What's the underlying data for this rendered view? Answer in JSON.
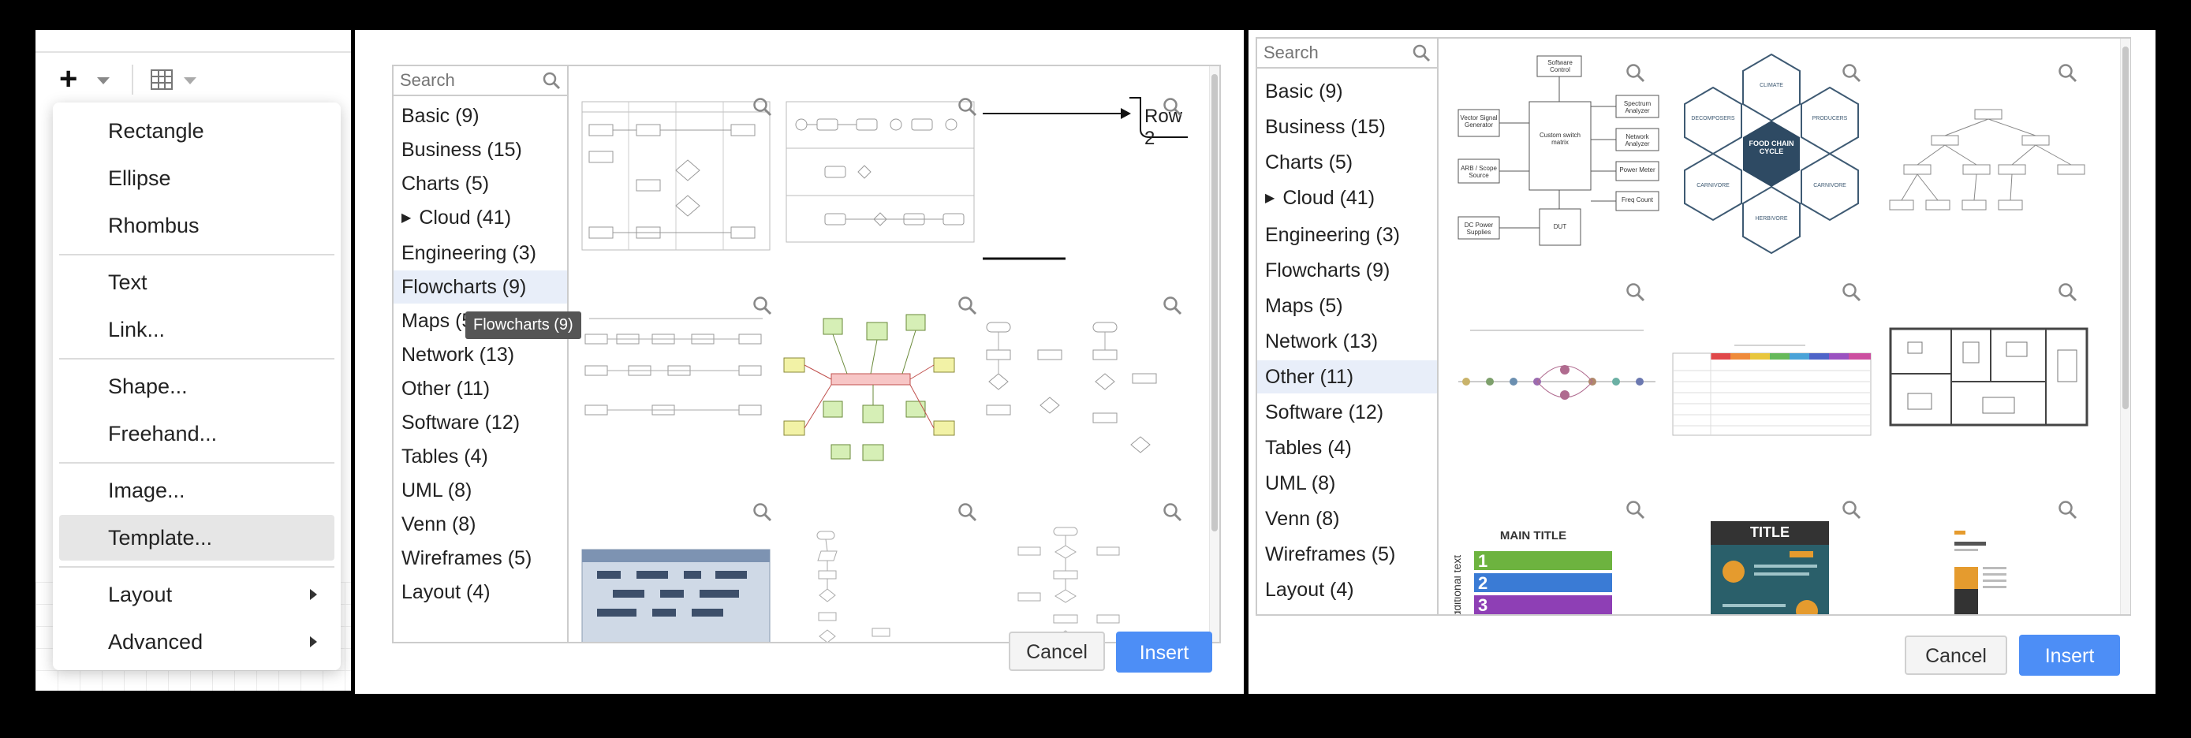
{
  "insert_menu": {
    "items": [
      {
        "label": "Rectangle"
      },
      {
        "label": "Ellipse"
      },
      {
        "label": "Rhombus"
      },
      {
        "label": "Text"
      },
      {
        "label": "Link..."
      },
      {
        "label": "Shape..."
      },
      {
        "label": "Freehand..."
      },
      {
        "label": "Image..."
      },
      {
        "label": "Template..."
      },
      {
        "label": "Layout"
      },
      {
        "label": "Advanced"
      }
    ],
    "active_item": "Template..."
  },
  "dialog_left": {
    "search_placeholder": "Search",
    "categories": [
      {
        "label": "Basic (9)"
      },
      {
        "label": "Business (15)"
      },
      {
        "label": "Charts (5)"
      },
      {
        "label": "Cloud (41)",
        "expandable": true
      },
      {
        "label": "Engineering (3)"
      },
      {
        "label": "Flowcharts (9)",
        "selected": true
      },
      {
        "label": "Maps (5)"
      },
      {
        "label": "Network (13)"
      },
      {
        "label": "Other (11)"
      },
      {
        "label": "Software (12)"
      },
      {
        "label": "Tables (4)"
      },
      {
        "label": "UML (8)"
      },
      {
        "label": "Venn (8)"
      },
      {
        "label": "Wireframes (5)"
      },
      {
        "label": "Layout (4)"
      }
    ],
    "tooltip": "Flowcharts (9)",
    "partial_thumb_text": "Row 2",
    "cancel_label": "Cancel",
    "insert_label": "Insert"
  },
  "dialog_right": {
    "search_placeholder": "Search",
    "categories": [
      {
        "label": "Basic (9)"
      },
      {
        "label": "Business (15)"
      },
      {
        "label": "Charts (5)"
      },
      {
        "label": "Cloud (41)",
        "expandable": true
      },
      {
        "label": "Engineering (3)"
      },
      {
        "label": "Flowcharts (9)"
      },
      {
        "label": "Maps (5)"
      },
      {
        "label": "Network (13)"
      },
      {
        "label": "Other (11)",
        "selected": true
      },
      {
        "label": "Software (12)"
      },
      {
        "label": "Tables (4)"
      },
      {
        "label": "UML (8)"
      },
      {
        "label": "Venn (8)"
      },
      {
        "label": "Wireframes (5)"
      },
      {
        "label": "Layout (4)"
      }
    ],
    "thumb_texts": {
      "food_chain": "FOOD CHAIN CYCLE",
      "hex_labels": [
        "CLIMATE",
        "PRODUCERS",
        "CARNIVORE",
        "HERBIVORE",
        "CARNIVORE",
        "DECOMPOSERS"
      ],
      "box_labels": [
        "Software Control",
        "Vector Signal Generator",
        "Custom switch matrix",
        "Spectrum Analyzer",
        "Network Analyzer",
        "ARB / Scope Source",
        "Power Meter",
        "Freq Count",
        "DC Power Supplies",
        "DUT"
      ],
      "main_title": "MAIN TITLE",
      "title_2": "TITLE",
      "side_text": "additional text",
      "steps": [
        "1",
        "2",
        "3"
      ]
    },
    "cancel_label": "Cancel",
    "insert_label": "Insert"
  },
  "colors": {
    "insert_button": "#4d8ef6",
    "selected_category": "#e8eef9",
    "menu_active": "#e6e6e6"
  }
}
